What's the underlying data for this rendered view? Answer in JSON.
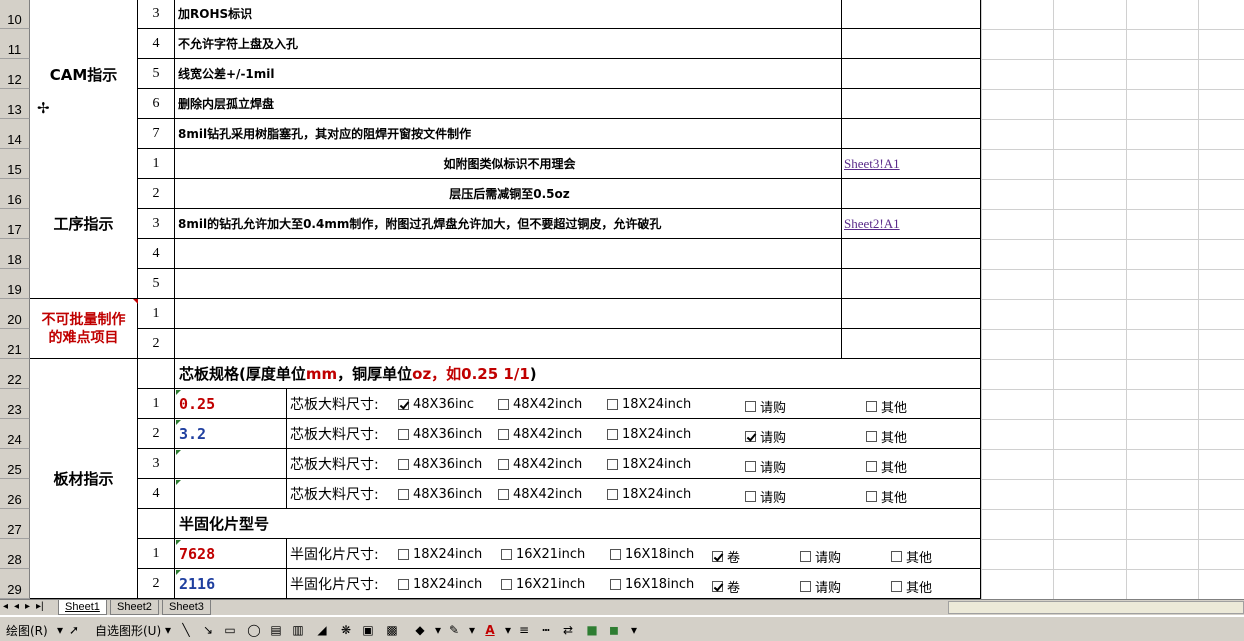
{
  "row_numbers": [
    "10",
    "11",
    "12",
    "13",
    "14",
    "15",
    "16",
    "17",
    "18",
    "19",
    "20",
    "21",
    "22",
    "23",
    "24",
    "25",
    "26",
    "27",
    "28",
    "29"
  ],
  "sections": {
    "cam": "CAM指示",
    "process": "工序指示",
    "difficult_line1": "不可批量制作",
    "difficult_line2": "的难点项目",
    "board": "板材指示"
  },
  "cam_rows": [
    {
      "num": "3",
      "text": "加ROHS标识"
    },
    {
      "num": "4",
      "text": "不允许字符上盘及入孔"
    },
    {
      "num": "5",
      "text": "线宽公差+/-1mil"
    },
    {
      "num": "6",
      "text": "删除内层孤立焊盘"
    },
    {
      "num": "7",
      "text": "8mil钻孔采用树脂塞孔，其对应的阻焊开窗按文件制作"
    }
  ],
  "process_rows": [
    {
      "num": "1",
      "text": "如附图类似标识不用理会",
      "link": "Sheet3!A1"
    },
    {
      "num": "2",
      "text": "层压后需减铜至0.5oz",
      "link": ""
    },
    {
      "num": "3",
      "text": "8mil的钻孔允许加大至0.4mm制作，附图过孔焊盘允许加大，但不要超过铜皮，允许破孔",
      "link": "Sheet2!A1"
    },
    {
      "num": "4",
      "text": "",
      "link": ""
    },
    {
      "num": "5",
      "text": "",
      "link": ""
    }
  ],
  "difficult_rows": [
    {
      "num": "1"
    },
    {
      "num": "2"
    }
  ],
  "core_header": {
    "a": "芯板规格(厚度单位",
    "b": "mm",
    "c": "，铜厚单位",
    "d": "oz，如0.25 1/1",
    "e": ")"
  },
  "core_rows": [
    {
      "num": "1",
      "value": "0.25",
      "value_color": "red",
      "label": "芯板大料尺寸:",
      "opts": [
        {
          "t": "48X36inc",
          "on": true
        },
        {
          "t": "48X42inch",
          "on": false
        },
        {
          "t": "18X24inch",
          "on": false
        },
        {
          "t": "请购",
          "on": false
        },
        {
          "t": "其他",
          "on": false
        }
      ]
    },
    {
      "num": "2",
      "value": "3.2",
      "value_color": "navy",
      "label": "芯板大料尺寸:",
      "opts": [
        {
          "t": "48X36inch",
          "on": false
        },
        {
          "t": "48X42inch",
          "on": false
        },
        {
          "t": "18X24inch",
          "on": false
        },
        {
          "t": "请购",
          "on": true
        },
        {
          "t": "其他",
          "on": false
        }
      ]
    },
    {
      "num": "3",
      "value": "",
      "value_color": "",
      "label": "芯板大料尺寸:",
      "opts": [
        {
          "t": "48X36inch",
          "on": false
        },
        {
          "t": "48X42inch",
          "on": false
        },
        {
          "t": "18X24inch",
          "on": false
        },
        {
          "t": "请购",
          "on": false
        },
        {
          "t": "其他",
          "on": false
        }
      ]
    },
    {
      "num": "4",
      "value": "",
      "value_color": "",
      "label": "芯板大料尺寸:",
      "opts": [
        {
          "t": "48X36inch",
          "on": false
        },
        {
          "t": "48X42inch",
          "on": false
        },
        {
          "t": "18X24inch",
          "on": false
        },
        {
          "t": "请购",
          "on": false
        },
        {
          "t": "其他",
          "on": false
        }
      ]
    }
  ],
  "prepreg_header": "半固化片型号",
  "prepreg_rows": [
    {
      "num": "1",
      "value": "7628",
      "value_color": "red",
      "label": "半固化片尺寸:",
      "opts": [
        {
          "t": "18X24inch",
          "on": false
        },
        {
          "t": "16X21inch",
          "on": false
        },
        {
          "t": "16X18inch",
          "on": false
        },
        {
          "t": "卷",
          "on": true
        },
        {
          "t": "请购",
          "on": false
        },
        {
          "t": "其他",
          "on": false
        }
      ]
    },
    {
      "num": "2",
      "value": "2116",
      "value_color": "navy",
      "label": "半固化片尺寸:",
      "opts": [
        {
          "t": "18X24inch",
          "on": false
        },
        {
          "t": "16X21inch",
          "on": false
        },
        {
          "t": "16X18inch",
          "on": false
        },
        {
          "t": "卷",
          "on": true
        },
        {
          "t": "请购",
          "on": false
        },
        {
          "t": "其他",
          "on": false
        }
      ]
    }
  ],
  "sheet_tabs": [
    "Sheet1",
    "Sheet2",
    "Sheet3"
  ],
  "active_tab": "Sheet1",
  "drawing_toolbar": {
    "draw_label": "绘图(R)",
    "autoshapes_label": "自选图形(U)"
  },
  "colors": {
    "red": "#c00000",
    "navy": "#1f3f9f",
    "link": "#5a2a8a",
    "chrome": "#d4d0c8"
  }
}
